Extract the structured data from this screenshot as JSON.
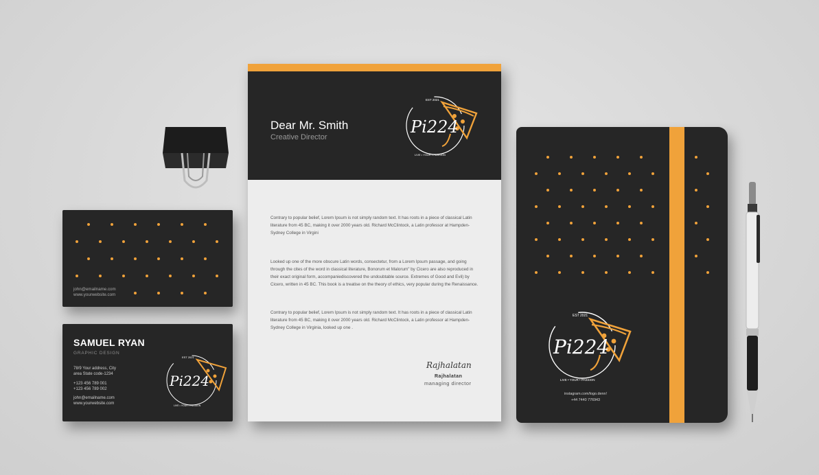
{
  "colors": {
    "accent": "#f0a23a",
    "dark": "#262626",
    "paper": "#ededed",
    "background": "#d9d9d9"
  },
  "brand": {
    "name": "Pi224",
    "est": "EST 2021",
    "tagline": "LIVE • YOUR • PASSION"
  },
  "business_card": {
    "name": "SAMUEL RYAN",
    "role": "GRAPHIC DESIGN",
    "address_line1": "78/9 Your address, City",
    "address_line2": "area State code-1234",
    "phone1": "+123 456 789 001",
    "phone2": "+123 456 789 002",
    "email": "john@emailname.com",
    "website": "www.yourwebsite.com"
  },
  "letterhead": {
    "greeting": "Dear Mr. Smith",
    "title": "Creative Director",
    "paragraph1": "Contrary to popular belief, Lorem Ipsum is not simply random text. It has roots in a piece of classical Latin literature from 45 BC, making it over 2000 years old. Richard McClintock, a Latin professor at Hampden-Sydney College in Virgini",
    "paragraph2": "Looked up one of the more obscure Latin words, consectetur, from a Lorem Ipsum passage, and going through the cites of the word in classical literature, Bonorum et Malorum\" by Cicero are also reproduced in their exact original form, accompaniediscovered the undoubtable source. Extremes of Good and Evil) by Cicero, written in 45 BC. This book is a treatise on the theory of ethics, very popular during the Renaissance.",
    "paragraph3": "Contrary to popular belief, Lorem Ipsum is not simply random text. It has roots in a piece of classical Latin literature from 45 BC, making it over 2000 years old. Richard McClintock, a Latin professor at Hampden-Sydney College in Virginia, looked up one .",
    "signature_script": "Rajhalatan",
    "signature_name": "Rajhalatan",
    "signature_role": "managing director"
  },
  "notebook": {
    "instagram": "instagram.com/logo.denn!",
    "phone": "+44 7440 776943"
  }
}
